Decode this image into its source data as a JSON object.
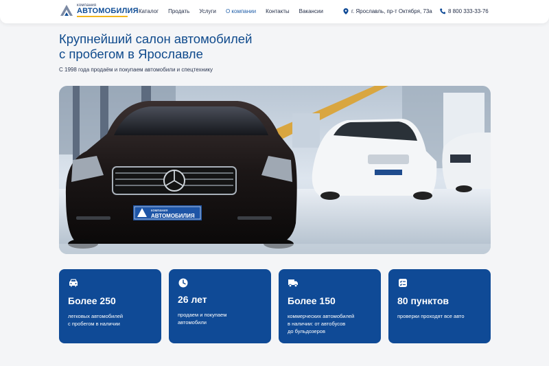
{
  "brand": {
    "small": "компания",
    "big": "АВТОМОБИЛИЯ"
  },
  "nav": [
    {
      "label": "Каталог",
      "active": false
    },
    {
      "label": "Продать",
      "active": false
    },
    {
      "label": "Услуги",
      "active": false
    },
    {
      "label": "О компании",
      "active": true
    },
    {
      "label": "Контакты",
      "active": false
    },
    {
      "label": "Вакансии",
      "active": false
    }
  ],
  "contacts": {
    "address": "г. Ярославль, пр-т Октября, 73а",
    "phone": "8 800 333-33-76"
  },
  "hero": {
    "title_line1": "Крупнейший салон автомобилей",
    "title_line2": "с пробегом в Ярославле",
    "subtitle": "С 1998 года продаём и покупаем автомобили и спецтехнику",
    "plate_small": "компания",
    "plate_big": "АВТОМОБИЛИЯ"
  },
  "stats": [
    {
      "icon": "car-icon",
      "value": "Более 250",
      "desc": "легковых автомобилей\nс пробегом в наличии"
    },
    {
      "icon": "clock-icon",
      "value": "26 лет",
      "desc": "продаем и покупаем\nавтомобили"
    },
    {
      "icon": "truck-icon",
      "value": "Более 150",
      "desc": "коммерческих автомобилей\nв наличии: от автобусов\nдо бульдозеров"
    },
    {
      "icon": "checklist-icon",
      "value": "80 пунктов",
      "desc": "проверки проходят все авто"
    }
  ],
  "colors": {
    "brand_blue": "#0f4a96",
    "accent_yellow": "#f2b51c",
    "background": "#f4f5f7"
  }
}
